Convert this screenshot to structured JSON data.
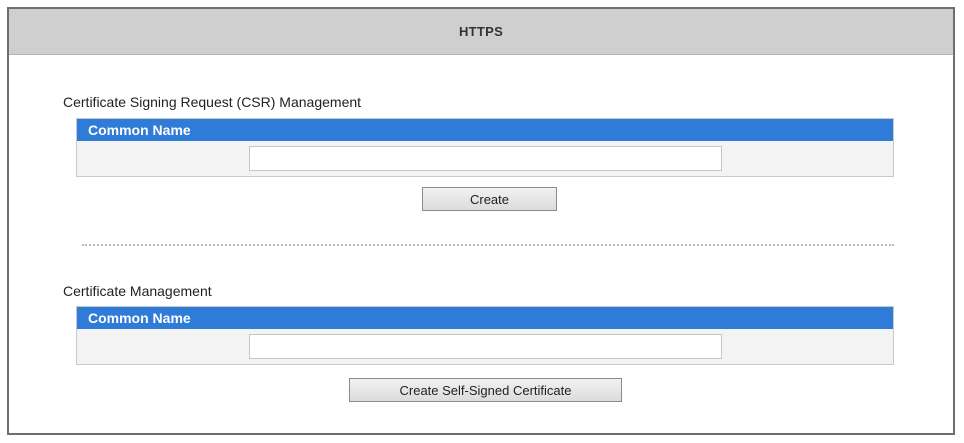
{
  "header": {
    "title": "HTTPS"
  },
  "csr_section": {
    "title": "Certificate Signing Request (CSR) Management",
    "table_header": "Common Name",
    "common_name_value": "",
    "button_label": "Create"
  },
  "cert_section": {
    "title": "Certificate Management",
    "table_header": "Common Name",
    "common_name_value": "",
    "button_label": "Create Self-Signed Certificate"
  },
  "colors": {
    "header_bg": "#cfcfcf",
    "table_header_bg": "#2f7bd8",
    "border": "#6e6e6e"
  }
}
